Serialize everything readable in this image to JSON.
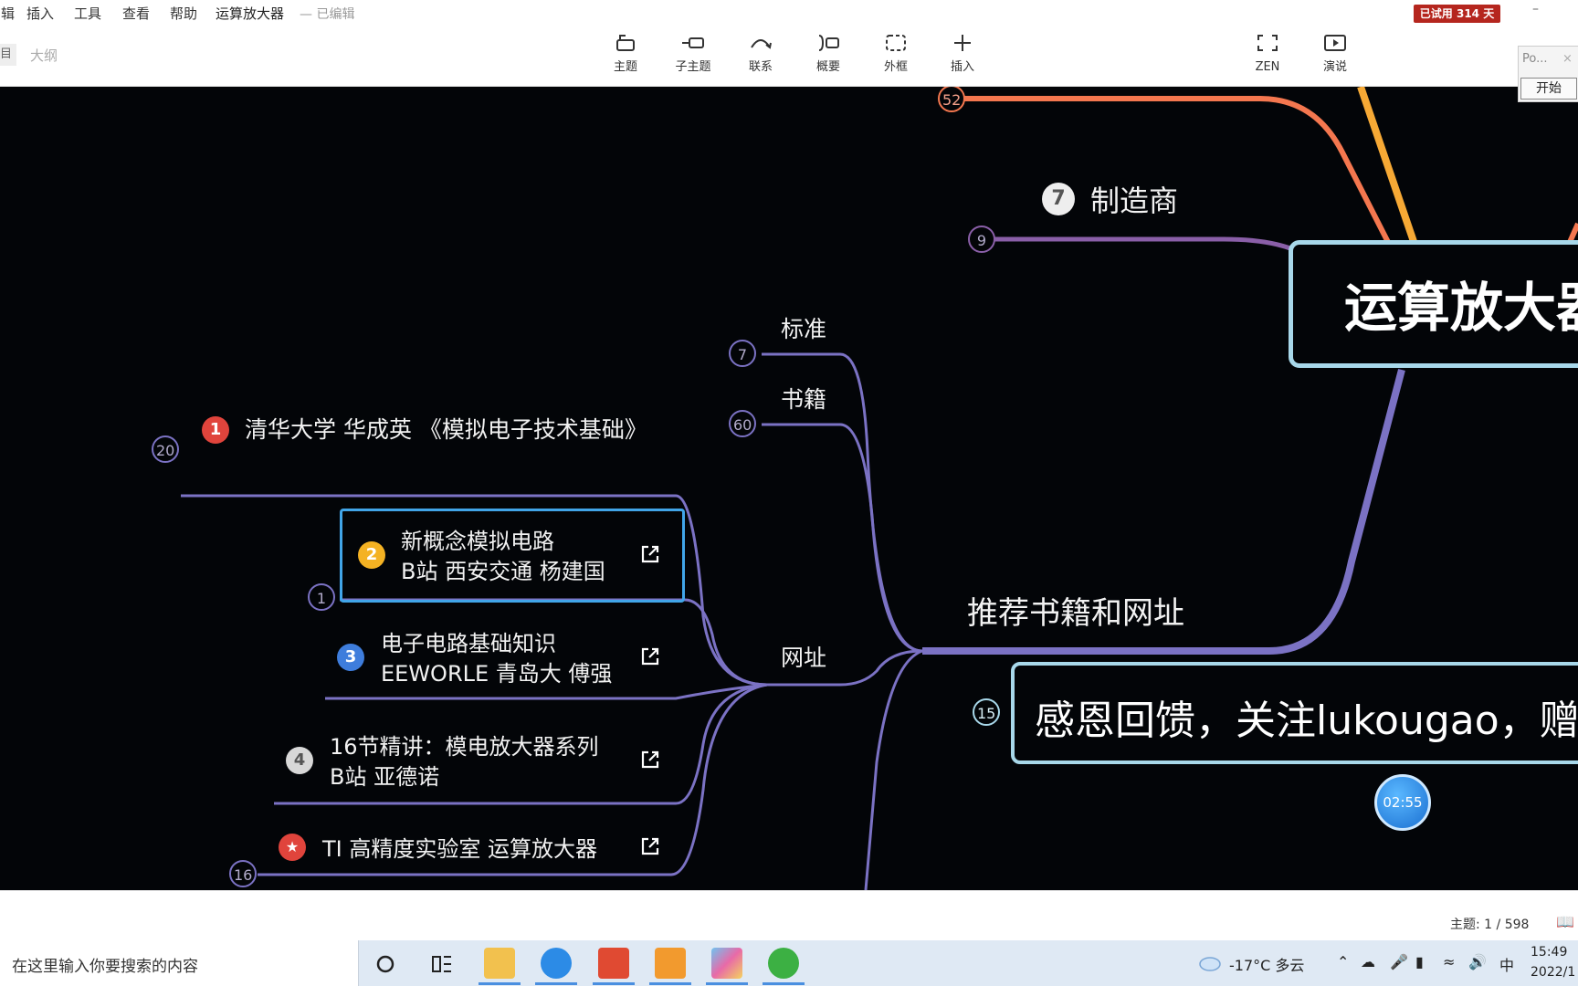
{
  "menu": {
    "items": [
      "编辑",
      "插入",
      "工具",
      "查看",
      "帮助"
    ],
    "doc_title": "运算放大器",
    "doc_status": "— 已编辑",
    "trial": "已试用 314 天",
    "minimize": "–"
  },
  "toolbar": {
    "outline_left": "目",
    "outline_tab": "大纲",
    "tools": [
      {
        "label": "主题",
        "icon": "topic-icon"
      },
      {
        "label": "子主题",
        "icon": "subtopic-icon"
      },
      {
        "label": "联系",
        "icon": "relationship-icon"
      },
      {
        "label": "概要",
        "icon": "summary-icon"
      },
      {
        "label": "外框",
        "icon": "boundary-icon"
      },
      {
        "label": "插入",
        "icon": "plus-icon"
      },
      {
        "label": "ZEN",
        "icon": "fullscreen-icon"
      },
      {
        "label": "演说",
        "icon": "present-icon"
      }
    ]
  },
  "popup": {
    "title": "Po...",
    "close": "×",
    "button": "开始"
  },
  "mindmap": {
    "root": "运算放大器",
    "manufacturer": {
      "marker": "7",
      "label": "制造商",
      "count": "9"
    },
    "top_count": "52",
    "branch_label": "推荐书籍和网址",
    "standards": {
      "label": "标准",
      "count": "7"
    },
    "books": {
      "label": "书籍",
      "count": "60"
    },
    "websites": {
      "label": "网址"
    },
    "links": [
      {
        "marker": "1",
        "text": "清华大学 华成英 《模拟电子技术基础》",
        "count": "20"
      },
      {
        "marker": "2",
        "line1": "新概念模拟电路",
        "line2": "B站 西安交通 杨建国",
        "count": "1"
      },
      {
        "marker": "3",
        "line1": "电子电路基础知识",
        "line2": "EEWORLE 青岛大 傅强"
      },
      {
        "marker": "4",
        "line1": "16节精讲：模电放大器系列",
        "line2": "B站 亚德诺"
      },
      {
        "marker": "★",
        "text": "TI 高精度实验室 运算放大器",
        "count": "16"
      }
    ],
    "feedback": {
      "text": "感恩回馈，关注lukougao，赠送",
      "count": "15"
    },
    "timer": "02:55",
    "colors": {
      "orange": "#f4774f",
      "amber": "#f6a935",
      "purple_dark": "#8a5fa8",
      "purple": "#7b72c4",
      "root_border": "#a8d8ea",
      "selection": "#41a5e8"
    }
  },
  "status": {
    "count": "主题: 1 / 598",
    "map_icon": "map-icon"
  },
  "taskbar": {
    "search": "在这里输入你要搜索的内容",
    "weather": "-17°C 多云",
    "ime": "中",
    "time": "15:49",
    "date": "2022/1"
  }
}
